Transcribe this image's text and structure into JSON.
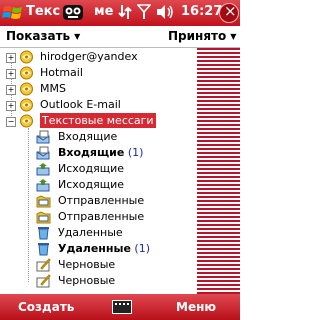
{
  "titlebar": {
    "title": "Текс",
    "title_tail": "ме",
    "time": "16:27",
    "status_icons": [
      "transfer-icon",
      "signal-icon",
      "volume-icon"
    ]
  },
  "header": {
    "show_label": "Показать",
    "sort_label": "Принято"
  },
  "tree": [
    {
      "label": "hirodger@yandex",
      "bold": false,
      "count": "",
      "type": "account",
      "expanded": false
    },
    {
      "label": "Hotmail",
      "bold": false,
      "count": "",
      "type": "account",
      "expanded": false
    },
    {
      "label": "MMS",
      "bold": false,
      "count": "",
      "type": "account",
      "expanded": false
    },
    {
      "label": "Outlook E-mail",
      "bold": false,
      "count": "",
      "type": "account",
      "expanded": false
    },
    {
      "label": "Текстовые мессаги",
      "bold": false,
      "count": "",
      "type": "account",
      "expanded": true,
      "selected": true
    },
    {
      "label": "Входящие",
      "bold": false,
      "count": "",
      "type": "inbox"
    },
    {
      "label": "Входящие",
      "bold": true,
      "count": "(1)",
      "type": "inbox"
    },
    {
      "label": "Исходящие",
      "bold": false,
      "count": "",
      "type": "outbox"
    },
    {
      "label": "Исходящие",
      "bold": false,
      "count": "",
      "type": "outbox"
    },
    {
      "label": "Отправленные",
      "bold": false,
      "count": "",
      "type": "sent"
    },
    {
      "label": "Отправленные",
      "bold": false,
      "count": "",
      "type": "sent"
    },
    {
      "label": "Удаленные",
      "bold": false,
      "count": "",
      "type": "deleted"
    },
    {
      "label": "Удаленные",
      "bold": true,
      "count": "(1)",
      "type": "deleted"
    },
    {
      "label": "Черновые",
      "bold": false,
      "count": "",
      "type": "drafts"
    },
    {
      "label": "Черновые",
      "bold": false,
      "count": "",
      "type": "drafts"
    }
  ],
  "bottombar": {
    "left_label": "Создать",
    "right_label": "Меню"
  },
  "colors": {
    "accent": "#c1121c",
    "selection": "#d52a33",
    "count": "#1a2aa8"
  }
}
